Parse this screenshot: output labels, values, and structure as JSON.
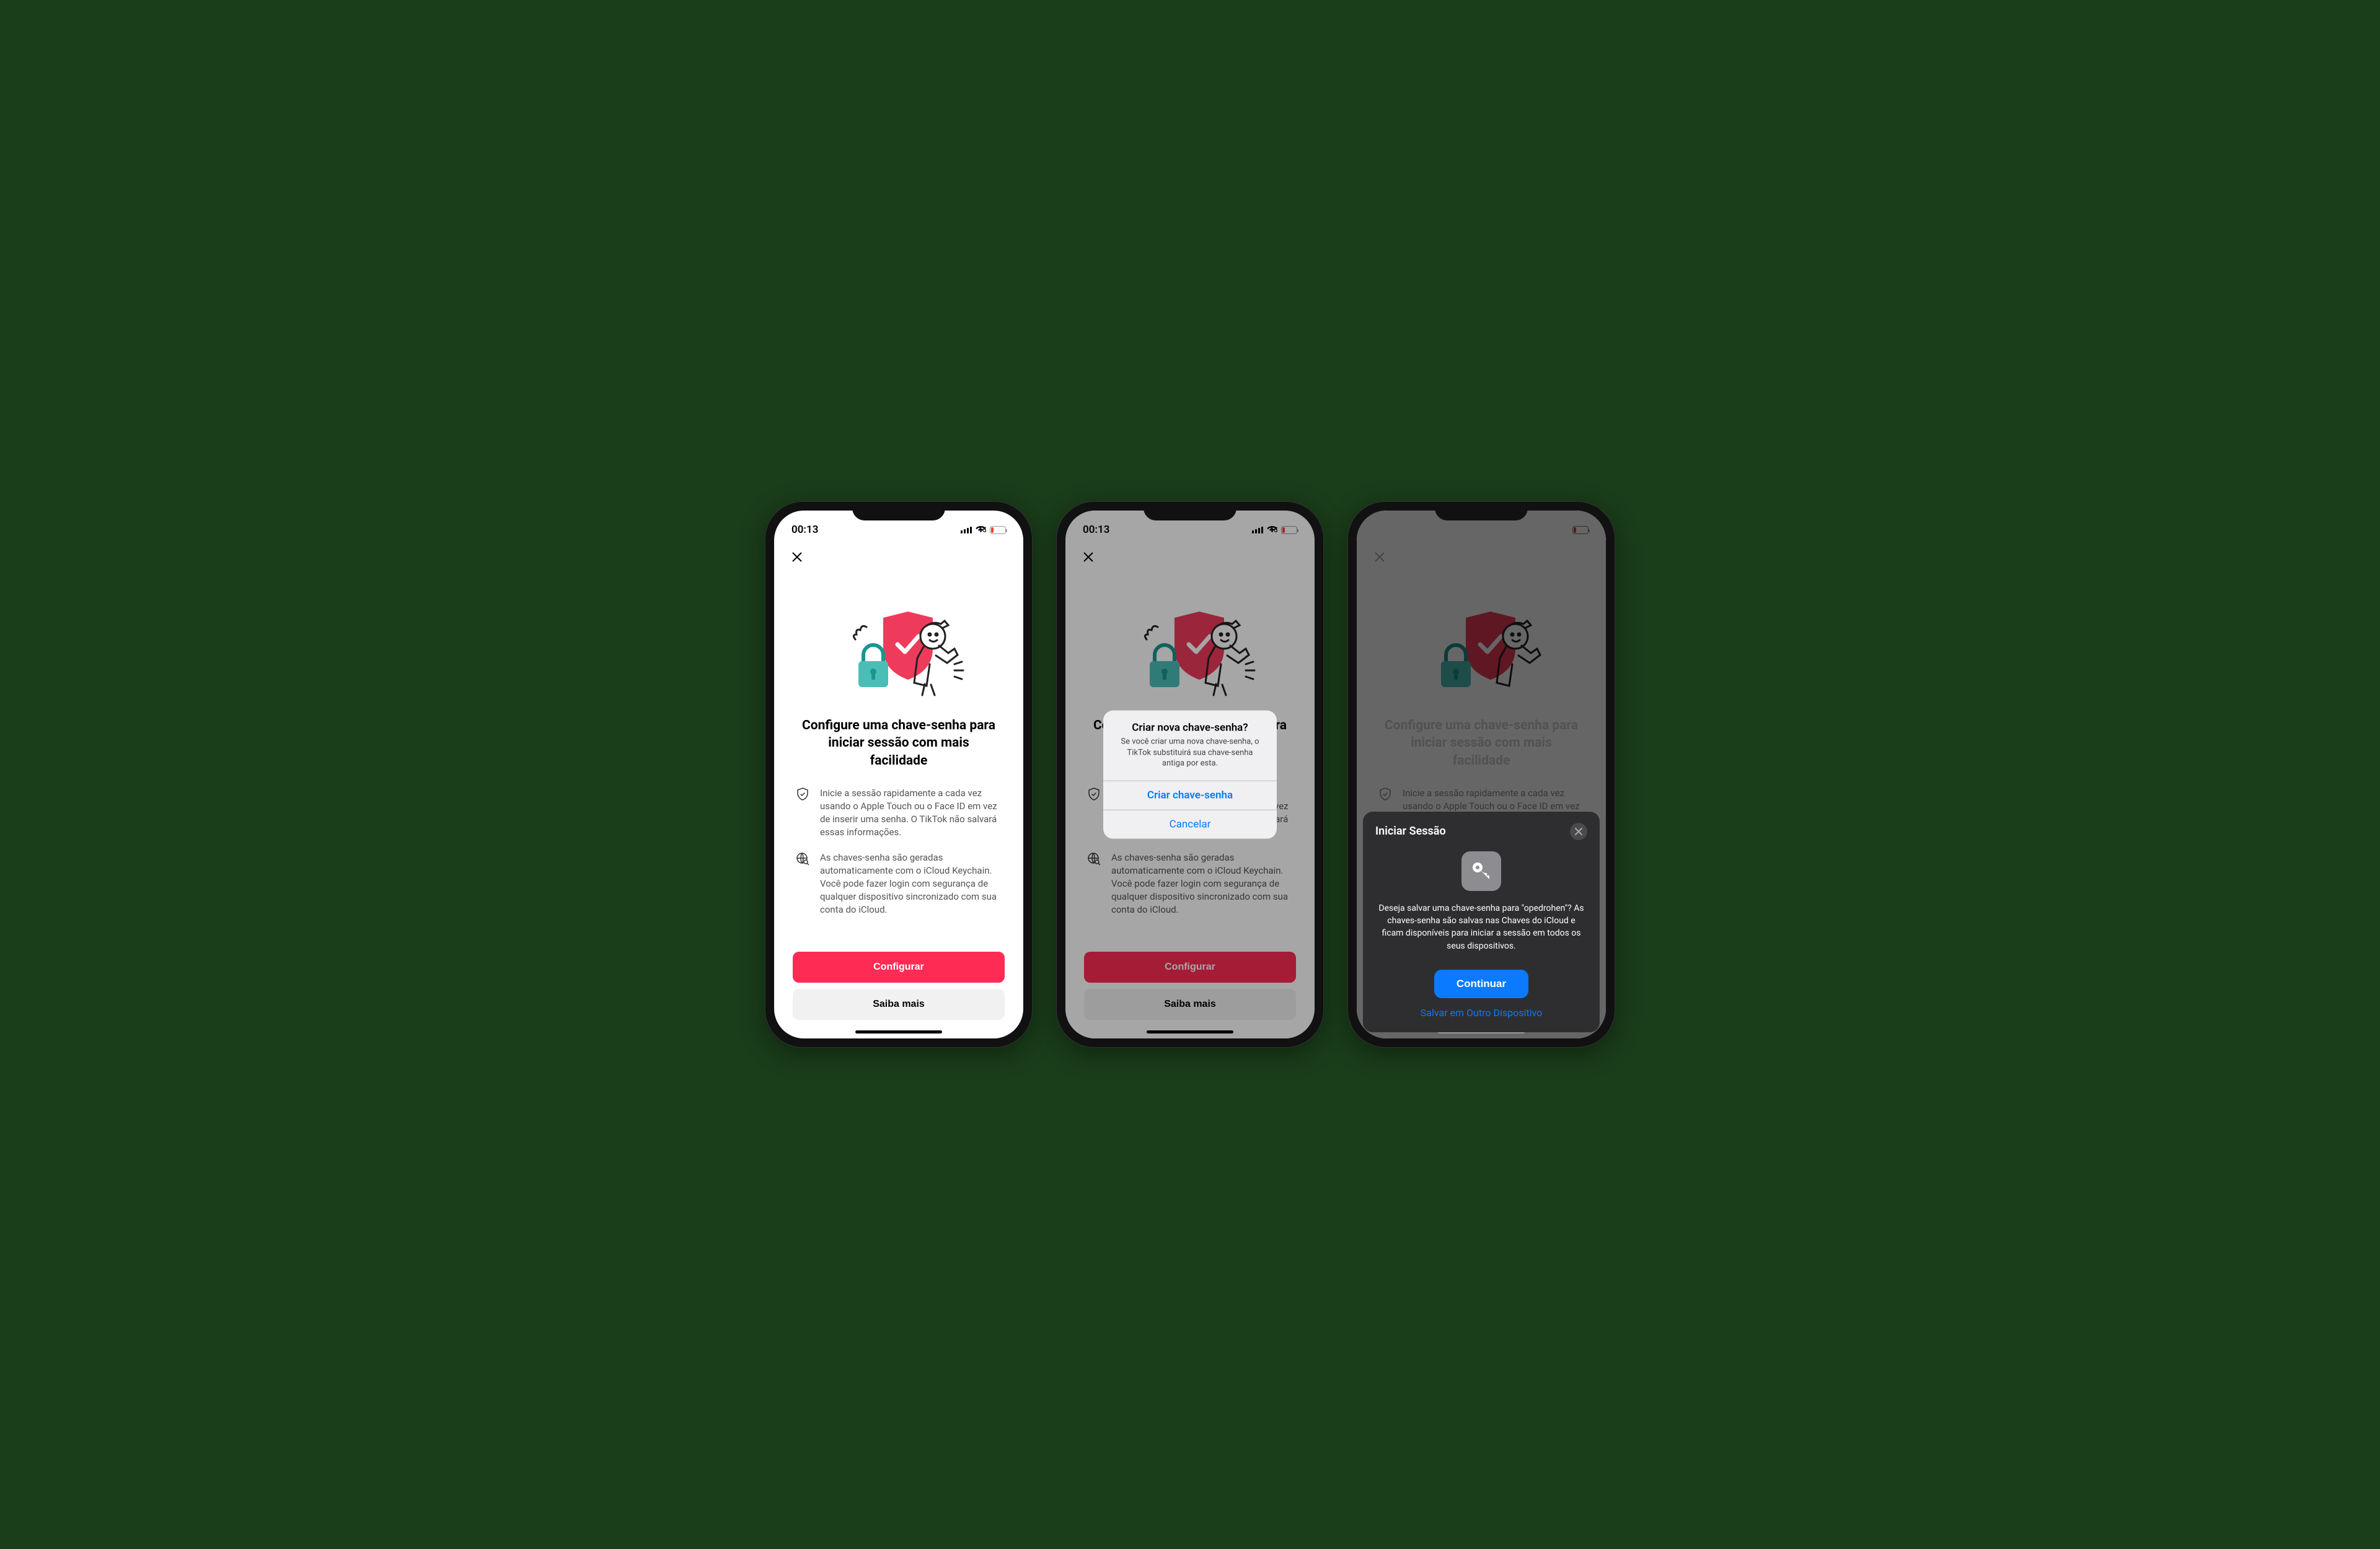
{
  "status": {
    "time": "00:13",
    "battery": "15"
  },
  "page": {
    "heading": "Configure uma chave-senha para iniciar sessão com mais facilidade",
    "bullet1": "Inicie a sessão rapidamente a cada vez usando o Apple Touch ou o Face ID em vez de inserir uma senha. O TikTok não salvará essas informações.",
    "bullet2": "As chaves-senha são geradas automaticamente com o iCloud Keychain. Você pode fazer login com segurança de qualquer dispositivo sincronizado com sua conta do iCloud.",
    "configure": "Configurar",
    "learn_more": "Saiba mais"
  },
  "alert": {
    "title": "Criar nova chave-senha?",
    "message": "Se você criar uma nova chave-senha, o TikTok substituirá sua chave-senha antiga por esta.",
    "primary": "Criar chave-senha",
    "cancel": "Cancelar"
  },
  "sheet": {
    "title": "Iniciar Sessão",
    "body": "Deseja salvar uma chave-senha para \"opedrohen\"? As chaves-senha são salvas nas Chaves do iCloud e ficam disponíveis para iniciar a sessão em todos os seus dispositivos.",
    "continue": "Continuar",
    "save_other": "Salvar em Outro Dispositivo"
  }
}
